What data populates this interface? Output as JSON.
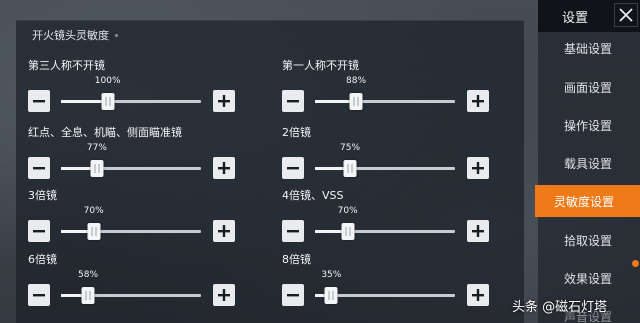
{
  "section_title": "开火镜头灵敏度",
  "sensitivity_items": [
    {
      "label": "第三人称不开镜",
      "value": 100,
      "value_text": "100%"
    },
    {
      "label": "第一人称不开镜",
      "value": 88,
      "value_text": "88%"
    },
    {
      "label": "红点、全息、机瞄、侧面瞄准镜",
      "value": 77,
      "value_text": "77%"
    },
    {
      "label": "2倍镜",
      "value": 75,
      "value_text": "75%"
    },
    {
      "label": "3倍镜",
      "value": 70,
      "value_text": "70%"
    },
    {
      "label": "4倍镜、VSS",
      "value": 70,
      "value_text": "70%"
    },
    {
      "label": "6倍镜",
      "value": 58,
      "value_text": "58%"
    },
    {
      "label": "8倍镜",
      "value": 35,
      "value_text": "35%"
    }
  ],
  "slider_max": 300,
  "sidebar": {
    "title": "设置",
    "items": [
      {
        "label": "基础设置"
      },
      {
        "label": "画面设置"
      },
      {
        "label": "操作设置"
      },
      {
        "label": "载具设置"
      },
      {
        "label": "灵敏度设置",
        "active": true
      },
      {
        "label": "拾取设置"
      },
      {
        "label": "效果设置"
      },
      {
        "label": "声音设置"
      }
    ]
  },
  "watermark": "头条 @磁石灯塔",
  "colors": {
    "accent": "#f07a18",
    "panel": "#1c2128"
  }
}
